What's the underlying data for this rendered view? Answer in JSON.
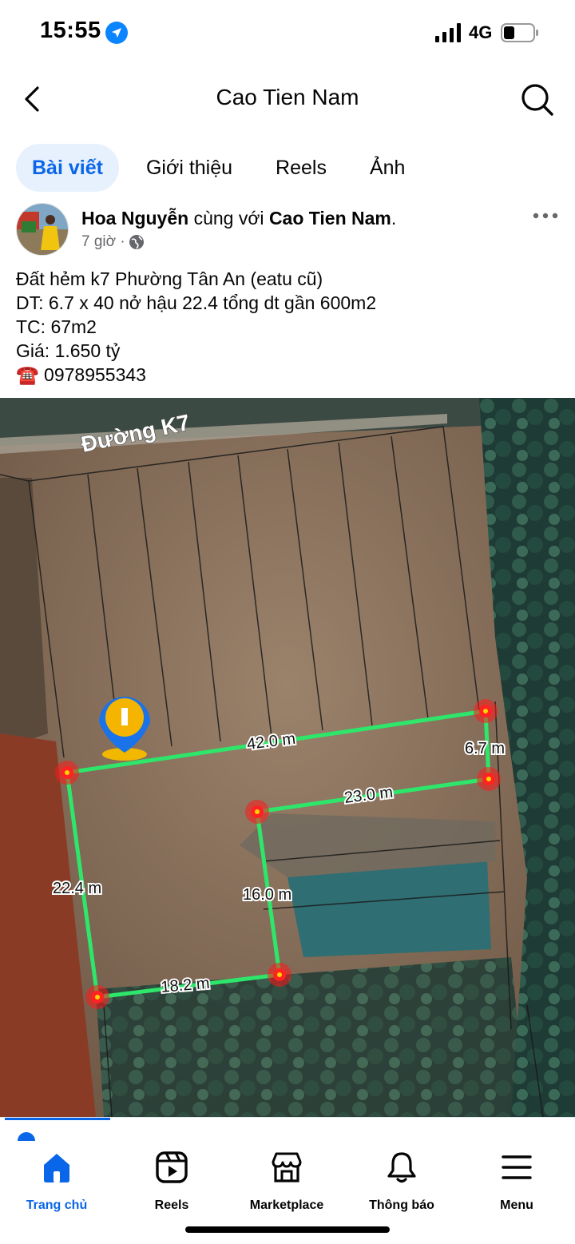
{
  "status_bar": {
    "time": "15:55",
    "network": "4G"
  },
  "header": {
    "title": "Cao Tien Nam"
  },
  "tabs": [
    {
      "label": "Bài viết",
      "active": true
    },
    {
      "label": "Giới thiệu",
      "active": false
    },
    {
      "label": "Reels",
      "active": false
    },
    {
      "label": "Ảnh",
      "active": false
    }
  ],
  "post": {
    "author": "Hoa Nguyễn",
    "with_text": "cùng với",
    "tagged": "Cao Tien Nam",
    "period": ".",
    "time": "7 giờ",
    "separator": "·",
    "lines": [
      "Đất hẻm k7 Phường Tân An (eatu cũ)",
      "DT: 6.7 x 40 nở hậu 22.4 tổng dt gần 600m2",
      "TC: 67m2",
      "Giá: 1.650 tỷ"
    ],
    "phone_emoji": "☎️",
    "phone": "0978955343"
  },
  "map": {
    "road_label": "Đường K7",
    "measurements": [
      "42.0 m",
      "6.7 m",
      "23.0 m",
      "22.4 m",
      "16.0 m",
      "18.2 m"
    ],
    "line_color": "#2ee66a",
    "vertex_color": "#ff1a1a"
  },
  "bottom_nav": [
    {
      "label": "Trang chủ",
      "icon": "home-icon",
      "active": true
    },
    {
      "label": "Reels",
      "icon": "reels-icon",
      "active": false
    },
    {
      "label": "Marketplace",
      "icon": "marketplace-icon",
      "active": false
    },
    {
      "label": "Thông báo",
      "icon": "bell-icon",
      "active": false
    },
    {
      "label": "Menu",
      "icon": "menu-icon",
      "active": false
    }
  ],
  "colors": {
    "accent": "#0a66e8",
    "tab_active_bg": "#e7f0fd"
  }
}
